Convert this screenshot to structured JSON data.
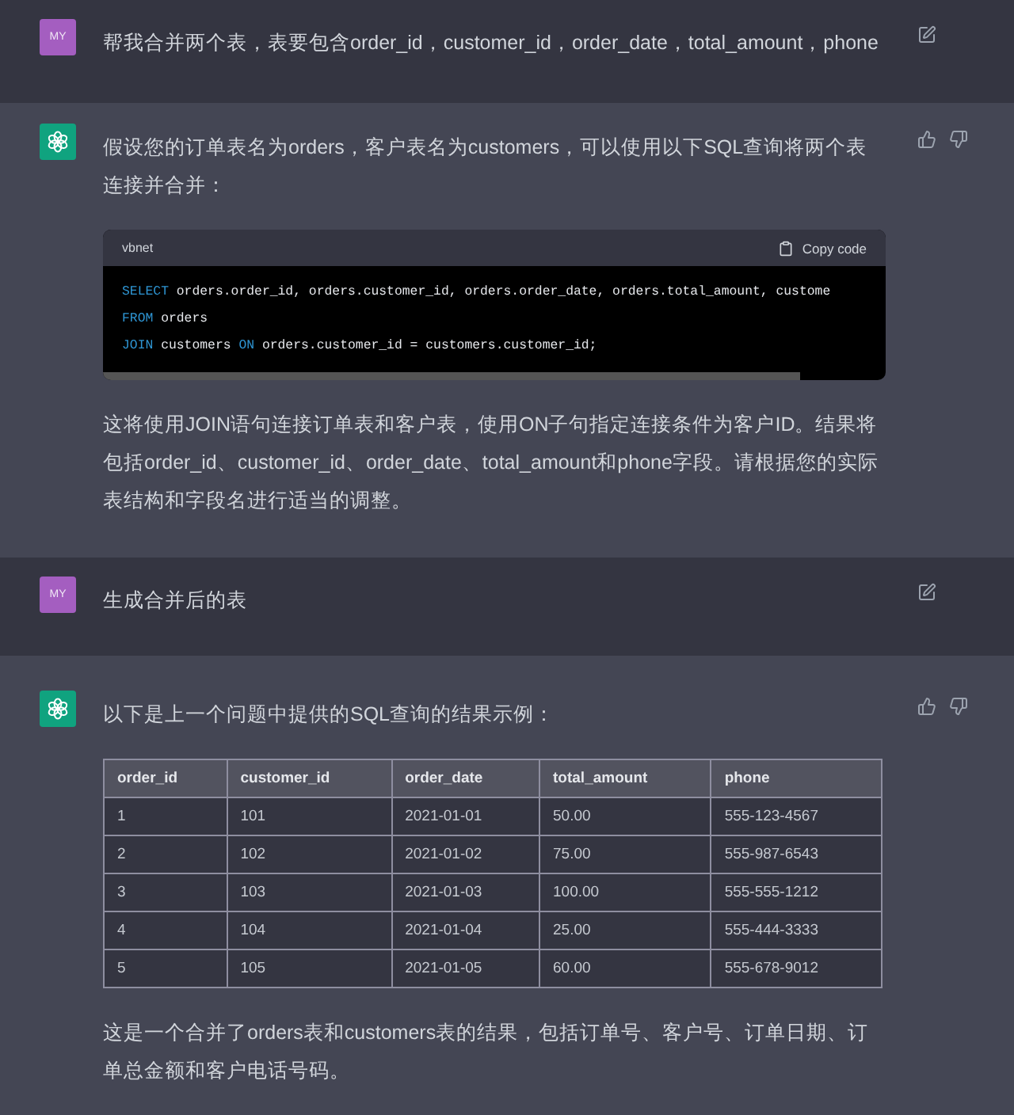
{
  "messages": [
    {
      "kind": "user",
      "avatar": "MY",
      "blocks": [
        {
          "kind": "text",
          "text": "帮我合并两个表，表要包含order_id，customer_id，order_date，total_amount，phone"
        }
      ]
    },
    {
      "kind": "assistant",
      "blocks": [
        {
          "kind": "text",
          "text": "假设您的订单表名为orders，客户表名为customers，可以使用以下SQL查询将两个表连接并合并："
        },
        {
          "kind": "code",
          "language": "vbnet",
          "copy_label": "Copy code",
          "lines": [
            [
              {
                "kind": "keyword",
                "text": "SELECT"
              },
              {
                "kind": "plain",
                "text": " orders.order_id, orders.customer_id, orders.order_date, orders.total_amount, custome"
              }
            ],
            [
              {
                "kind": "keyword",
                "text": "FROM"
              },
              {
                "kind": "plain",
                "text": " orders"
              }
            ],
            [
              {
                "kind": "keyword",
                "text": "JOIN"
              },
              {
                "kind": "plain",
                "text": " customers "
              },
              {
                "kind": "keyword",
                "text": "ON"
              },
              {
                "kind": "plain",
                "text": " orders.customer_id = customers.customer_id;"
              }
            ]
          ]
        },
        {
          "kind": "text",
          "text": "这将使用JOIN语句连接订单表和客户表，使用ON子句指定连接条件为客户ID。结果将包括order_id、customer_id、order_date、total_amount和phone字段。请根据您的实际表结构和字段名进行适当的调整。"
        }
      ]
    },
    {
      "kind": "user",
      "avatar": "MY",
      "blocks": [
        {
          "kind": "text",
          "text": "生成合并后的表"
        }
      ]
    },
    {
      "kind": "assistant",
      "blocks": [
        {
          "kind": "text",
          "text": "以下是上一个问题中提供的SQL查询的结果示例："
        },
        {
          "kind": "table",
          "columns": [
            "order_id",
            "customer_id",
            "order_date",
            "total_amount",
            "phone"
          ],
          "rows": [
            [
              "1",
              "101",
              "2021-01-01",
              "50.00",
              "555-123-4567"
            ],
            [
              "2",
              "102",
              "2021-01-02",
              "75.00",
              "555-987-6543"
            ],
            [
              "3",
              "103",
              "2021-01-03",
              "100.00",
              "555-555-1212"
            ],
            [
              "4",
              "104",
              "2021-01-04",
              "25.00",
              "555-444-3333"
            ],
            [
              "5",
              "105",
              "2021-01-05",
              "60.00",
              "555-678-9012"
            ]
          ]
        },
        {
          "kind": "text",
          "text": "这是一个合并了orders表和customers表的结果，包括订单号、客户号、订单日期、订单总金额和客户电话号码。"
        }
      ]
    }
  ]
}
